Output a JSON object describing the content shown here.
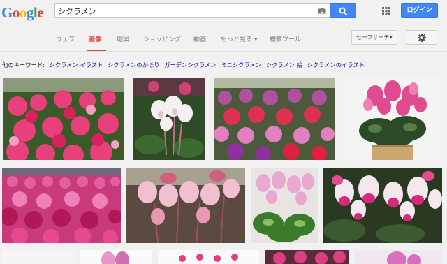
{
  "logo": [
    "G",
    "o",
    "o",
    "g",
    "l",
    "e"
  ],
  "logo_colors": [
    "#4285f4",
    "#ea4335",
    "#fbbc05",
    "#4285f4",
    "#34a853",
    "#ea4335"
  ],
  "search": {
    "query": "シクラメン",
    "camera_icon": "camera-icon",
    "search_icon": "search-icon"
  },
  "header": {
    "apps_icon": "apps-grid-icon",
    "login_label": "ログイン"
  },
  "tabs": [
    {
      "label": "ウェブ",
      "active": false
    },
    {
      "label": "画像",
      "active": true
    },
    {
      "label": "地図",
      "active": false
    },
    {
      "label": "ショッピング",
      "active": false
    },
    {
      "label": "動画",
      "active": false
    },
    {
      "label": "もっと見る",
      "active": false
    },
    {
      "label": "検索ツール",
      "active": false
    }
  ],
  "safe_search_label": "セーフサーチ",
  "settings_icon": "gear-icon",
  "related": {
    "prefix": "他のキーワード:",
    "links": [
      "シクラメン イラスト",
      "シクラメンのかほり",
      "ガーデンシクラメン",
      "ミニシクラメン",
      "シクラメン 絵",
      "シクラメンのイラスト"
    ]
  },
  "colors": {
    "accent_blue": "#4285f4",
    "active_tab": "#dd4b39",
    "link": "#1a0dab"
  },
  "images": [
    {
      "name": "cyclamen-greenhouse-rows"
    },
    {
      "name": "white-cyclamen-closeup"
    },
    {
      "name": "cyclamen-pot-display"
    },
    {
      "name": "pink-cyclamen-pot"
    },
    {
      "name": "pink-cyclamen-field"
    },
    {
      "name": "pale-pink-cyclamen-stems"
    },
    {
      "name": "light-pink-cyclamen-leaves"
    },
    {
      "name": "bicolor-cyclamen-closeup"
    },
    {
      "name": "partial-image-1"
    },
    {
      "name": "partial-image-2"
    },
    {
      "name": "partial-image-3"
    },
    {
      "name": "partial-image-4"
    },
    {
      "name": "partial-image-5"
    }
  ]
}
